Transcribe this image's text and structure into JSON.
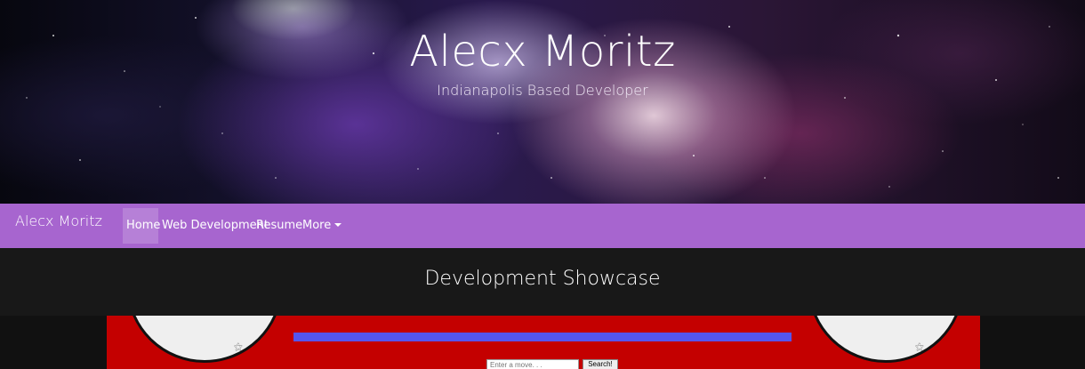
{
  "hero": {
    "title": "Alecx Moritz",
    "subtitle": "Indianapolis Based Developer"
  },
  "navbar": {
    "brand": "Alecx Moritz",
    "items": [
      {
        "label": "Home",
        "active": true
      },
      {
        "label": "Web Development"
      },
      {
        "label": "Resume"
      },
      {
        "label": "More",
        "dropdown": true
      }
    ],
    "background": "#a765cf"
  },
  "section": {
    "heading": "Development Showcase"
  },
  "showcase": {
    "background": "#c40000",
    "hp_bar_color": "#5555ee",
    "input_placeholder": "Enter a move. . .",
    "button_label": "Search!"
  }
}
